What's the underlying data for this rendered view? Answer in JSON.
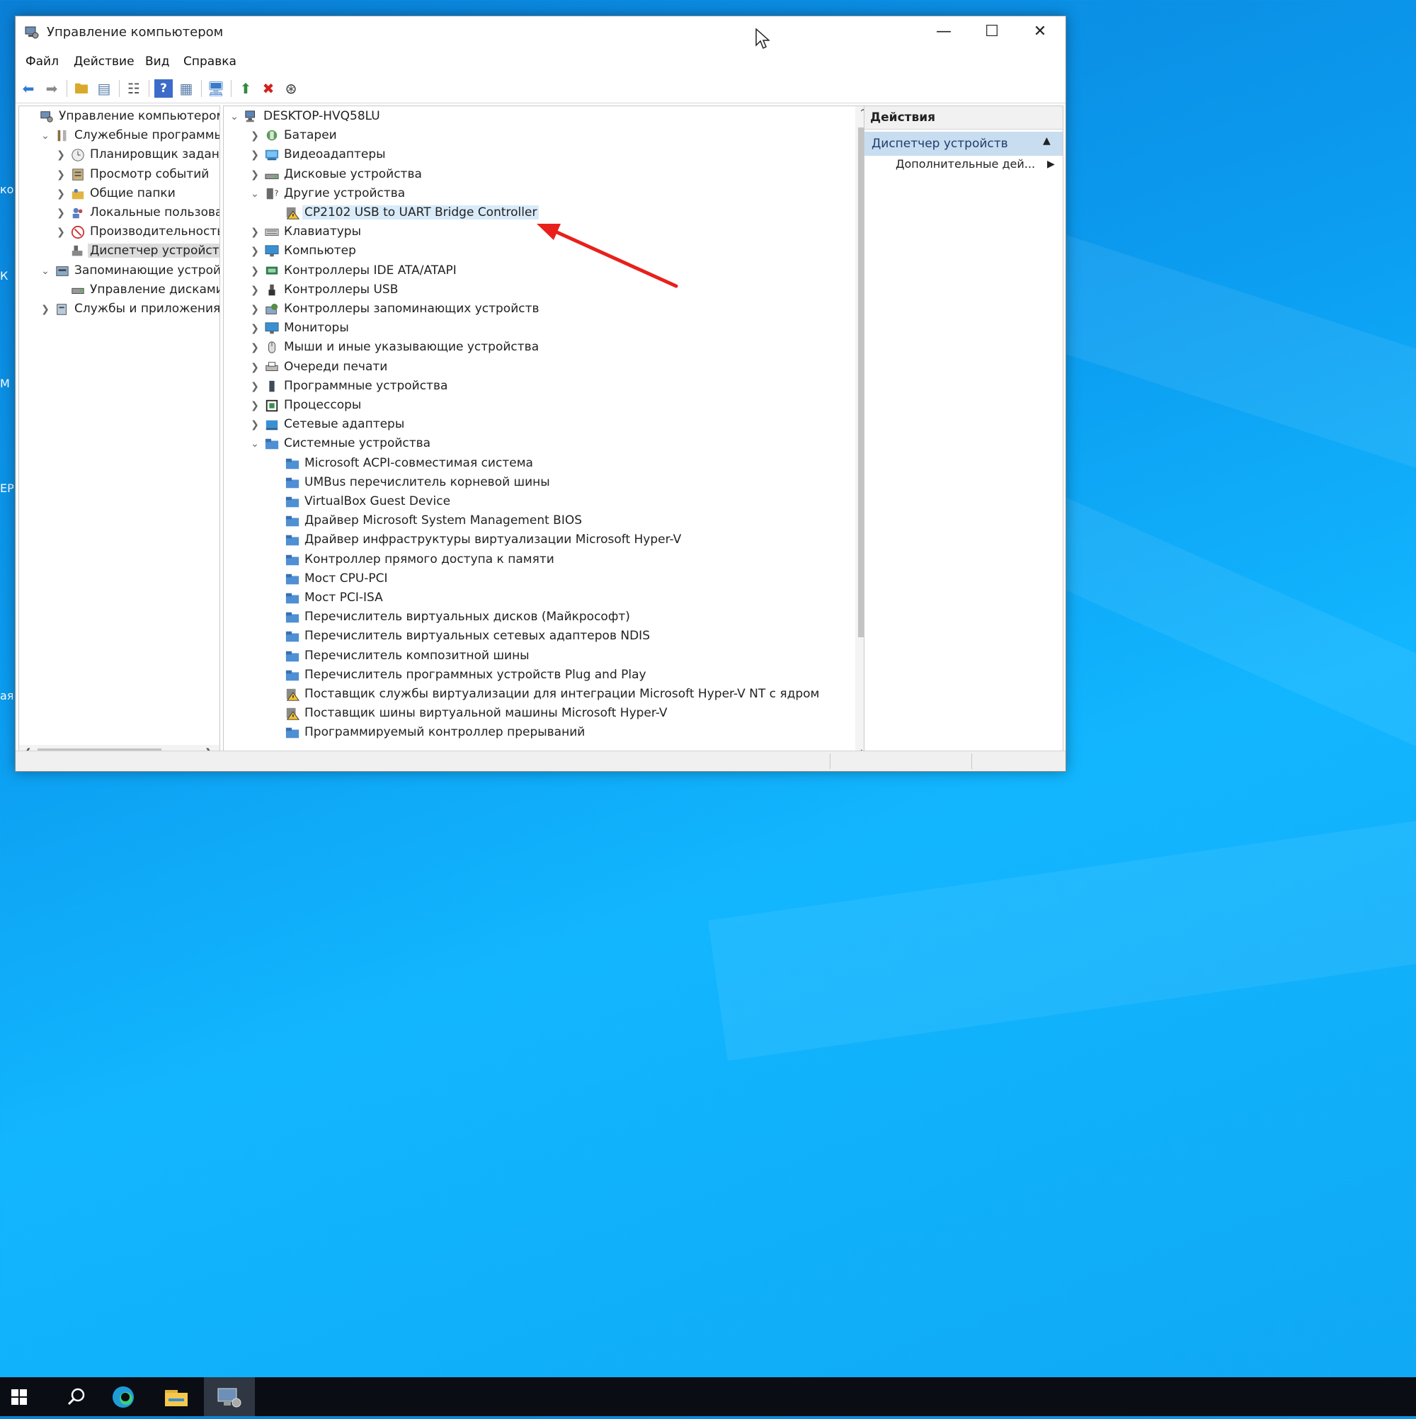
{
  "window": {
    "title": "Управление компьютером",
    "minimize_icon": "minimize-icon",
    "maximize_icon": "maximize-icon",
    "close_icon": "close-icon"
  },
  "menu": [
    "Файл",
    "Действие",
    "Вид",
    "Справка"
  ],
  "toolbar_icons": [
    "back-arrow-icon",
    "forward-arrow-icon",
    "up-folder-icon",
    "show-hide-console-tree-icon",
    "properties-icon",
    "help-icon",
    "view-icon",
    "monitor-icon",
    "update-driver-icon",
    "uninstall-icon",
    "scan-hardware-icon"
  ],
  "left_tree": [
    {
      "label": "Управление компьютером (л",
      "level": 0,
      "chevron": "",
      "icon": "computer-management-icon"
    },
    {
      "label": "Служебные программы",
      "level": 1,
      "chevron": "v",
      "icon": "tools-icon"
    },
    {
      "label": "Планировщик заданий",
      "level": 2,
      "chevron": ">",
      "icon": "clock-icon"
    },
    {
      "label": "Просмотр событий",
      "level": 2,
      "chevron": ">",
      "icon": "event-viewer-icon"
    },
    {
      "label": "Общие папки",
      "level": 2,
      "chevron": ">",
      "icon": "shared-folder-icon"
    },
    {
      "label": "Локальные пользовате",
      "level": 2,
      "chevron": ">",
      "icon": "users-icon"
    },
    {
      "label": "Производительность",
      "level": 2,
      "chevron": ">",
      "icon": "performance-icon"
    },
    {
      "label": "Диспетчер устройств",
      "level": 2,
      "chevron": "",
      "icon": "device-manager-icon",
      "selected": true
    },
    {
      "label": "Запоминающие устройст",
      "level": 1,
      "chevron": "v",
      "icon": "storage-icon"
    },
    {
      "label": "Управление дисками",
      "level": 2,
      "chevron": "",
      "icon": "disk-management-icon"
    },
    {
      "label": "Службы и приложения",
      "level": 1,
      "chevron": ">",
      "icon": "services-icon"
    }
  ],
  "device_tree": [
    {
      "label": "DESKTOP-HVQ58LU",
      "level": 0,
      "chevron": "v",
      "icon": "computer-icon"
    },
    {
      "label": "Батареи",
      "level": 1,
      "chevron": ">",
      "icon": "battery-icon"
    },
    {
      "label": "Видеоадаптеры",
      "level": 1,
      "chevron": ">",
      "icon": "display-adapter-icon"
    },
    {
      "label": "Дисковые устройства",
      "level": 1,
      "chevron": ">",
      "icon": "disk-drive-icon"
    },
    {
      "label": "Другие устройства",
      "level": 1,
      "chevron": "v",
      "icon": "unknown-device-icon"
    },
    {
      "label": "CP2102 USB to UART Bridge Controller",
      "level": 2,
      "chevron": "",
      "icon": "warning-device-icon",
      "highlight": true
    },
    {
      "label": "Клавиатуры",
      "level": 1,
      "chevron": ">",
      "icon": "keyboard-icon"
    },
    {
      "label": "Компьютер",
      "level": 1,
      "chevron": ">",
      "icon": "monitor-icon"
    },
    {
      "label": "Контроллеры IDE ATA/ATAPI",
      "level": 1,
      "chevron": ">",
      "icon": "ide-controller-icon"
    },
    {
      "label": "Контроллеры USB",
      "level": 1,
      "chevron": ">",
      "icon": "usb-icon"
    },
    {
      "label": "Контроллеры запоминающих устройств",
      "level": 1,
      "chevron": ">",
      "icon": "storage-controller-icon"
    },
    {
      "label": "Мониторы",
      "level": 1,
      "chevron": ">",
      "icon": "monitor-icon"
    },
    {
      "label": "Мыши и иные указывающие устройства",
      "level": 1,
      "chevron": ">",
      "icon": "mouse-icon"
    },
    {
      "label": "Очереди печати",
      "level": 1,
      "chevron": ">",
      "icon": "printer-icon"
    },
    {
      "label": "Программные устройства",
      "level": 1,
      "chevron": ">",
      "icon": "software-device-icon"
    },
    {
      "label": "Процессоры",
      "level": 1,
      "chevron": ">",
      "icon": "processor-icon"
    },
    {
      "label": "Сетевые адаптеры",
      "level": 1,
      "chevron": ">",
      "icon": "network-adapter-icon"
    },
    {
      "label": "Системные устройства",
      "level": 1,
      "chevron": "v",
      "icon": "system-folder-icon"
    },
    {
      "label": "Microsoft ACPI-совместимая система",
      "level": 2,
      "chevron": "",
      "icon": "system-folder-icon"
    },
    {
      "label": "UMBus перечислитель корневой шины",
      "level": 2,
      "chevron": "",
      "icon": "system-folder-icon"
    },
    {
      "label": "VirtualBox Guest Device",
      "level": 2,
      "chevron": "",
      "icon": "system-folder-icon"
    },
    {
      "label": "Драйвер Microsoft System Management BIOS",
      "level": 2,
      "chevron": "",
      "icon": "system-folder-icon"
    },
    {
      "label": "Драйвер инфраструктуры виртуализации Microsoft Hyper-V",
      "level": 2,
      "chevron": "",
      "icon": "system-folder-icon"
    },
    {
      "label": "Контроллер прямого доступа к памяти",
      "level": 2,
      "chevron": "",
      "icon": "system-folder-icon"
    },
    {
      "label": "Мост CPU-PCI",
      "level": 2,
      "chevron": "",
      "icon": "system-folder-icon"
    },
    {
      "label": "Мост PCI-ISA",
      "level": 2,
      "chevron": "",
      "icon": "system-folder-icon"
    },
    {
      "label": "Перечислитель виртуальных дисков (Майкрософт)",
      "level": 2,
      "chevron": "",
      "icon": "system-folder-icon"
    },
    {
      "label": "Перечислитель виртуальных сетевых адаптеров NDIS",
      "level": 2,
      "chevron": "",
      "icon": "system-folder-icon"
    },
    {
      "label": "Перечислитель композитной шины",
      "level": 2,
      "chevron": "",
      "icon": "system-folder-icon"
    },
    {
      "label": "Перечислитель программных устройств Plug and Play",
      "level": 2,
      "chevron": "",
      "icon": "system-folder-icon"
    },
    {
      "label": "Поставщик службы виртуализации для интеграции Microsoft Hyper-V NT с ядром",
      "level": 2,
      "chevron": "",
      "icon": "warning-device-icon"
    },
    {
      "label": "Поставщик шины виртуальной машины Microsoft Hyper-V",
      "level": 2,
      "chevron": "",
      "icon": "warning-device-icon"
    },
    {
      "label": "Программируемый контроллер прерываний",
      "level": 2,
      "chevron": "",
      "icon": "system-folder-icon"
    }
  ],
  "actions": {
    "header": "Действия",
    "section": "Диспетчер устройств",
    "more": "Дополнительные дей..."
  },
  "desktop_edge_text": [
    "ко",
    "К",
    "М",
    "ЕР",
    "ая"
  ],
  "taskbar": [
    "windows-start-icon",
    "search-icon",
    "edge-icon",
    "file-explorer-icon",
    "computer-management-icon"
  ],
  "colors": {
    "accent": "#0b9bef",
    "annotation_arrow": "#e8201b",
    "selection": "#d9ebf9"
  }
}
